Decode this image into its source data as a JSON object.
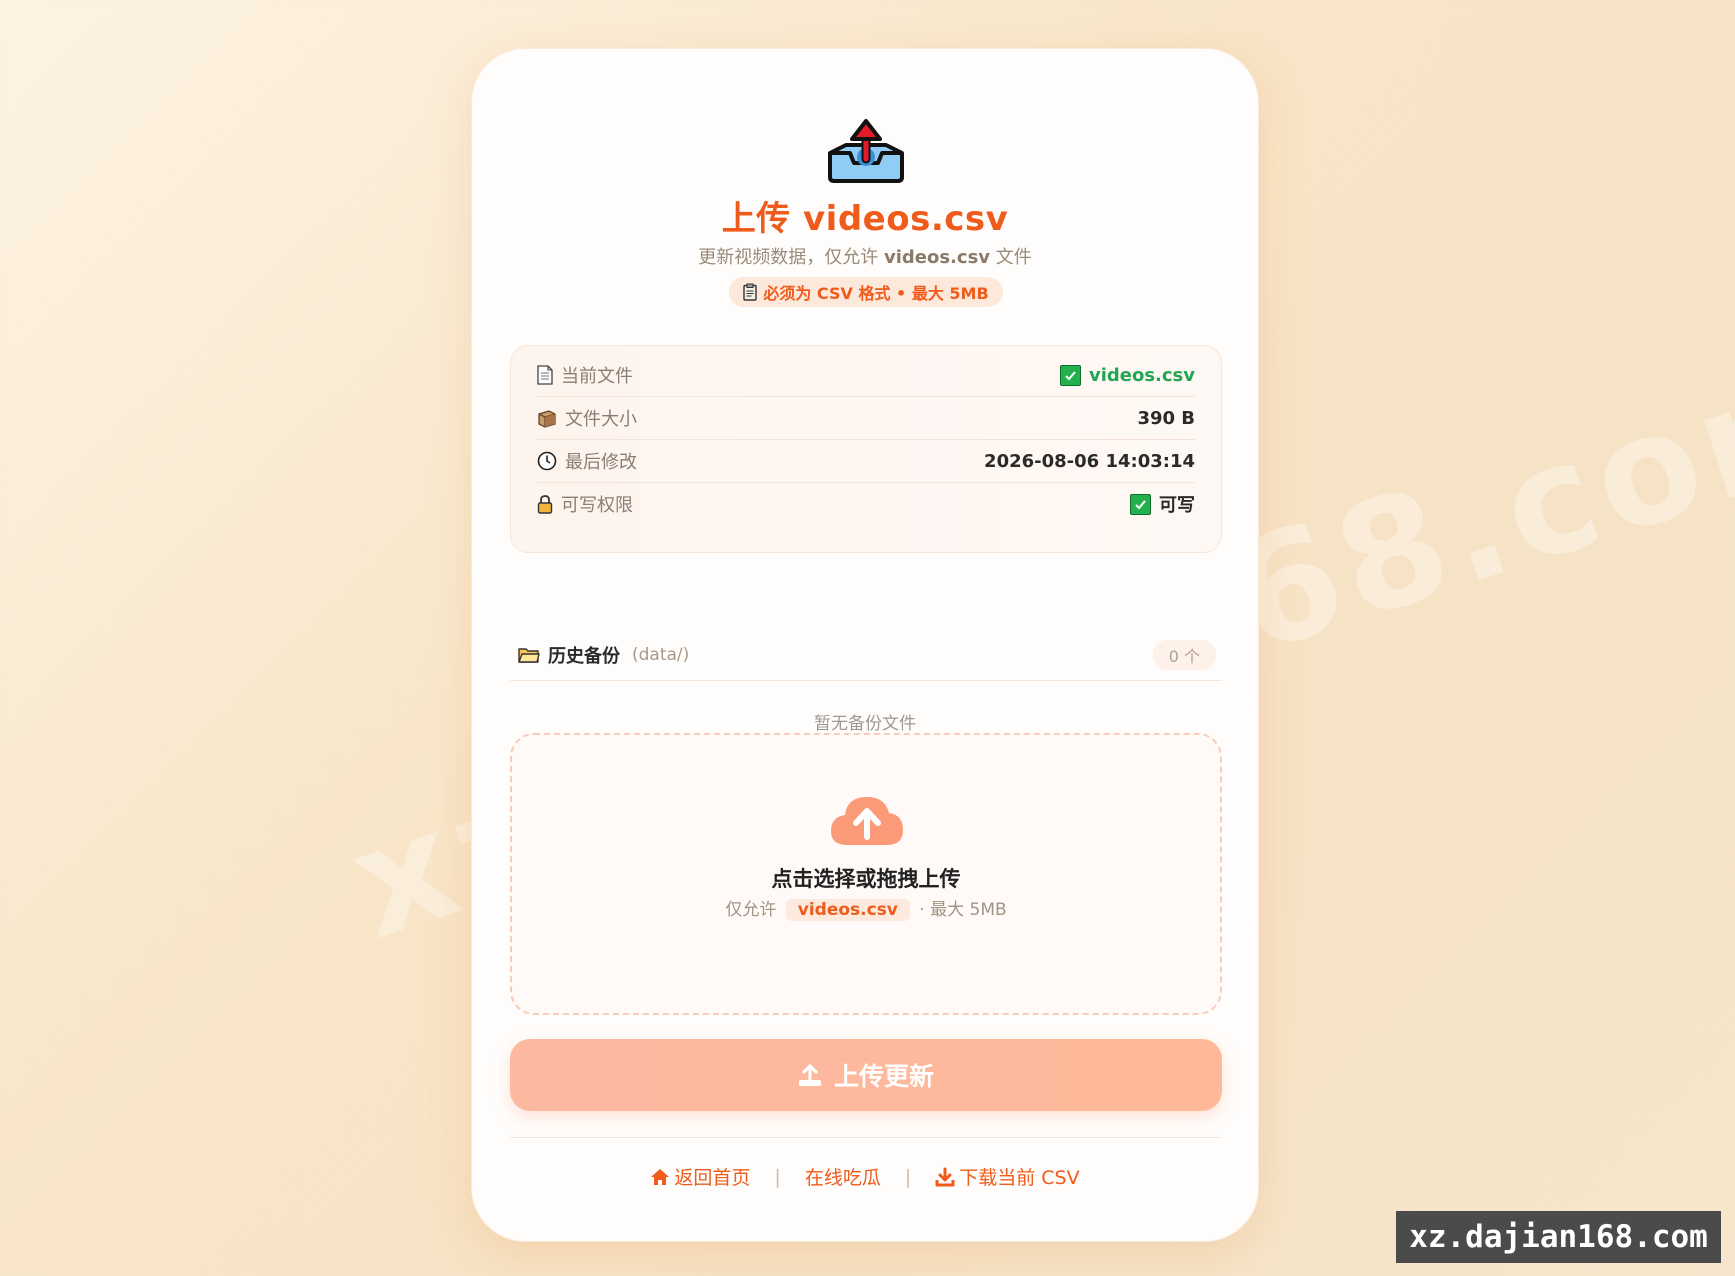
{
  "page": {
    "title": "上传 videos.csv",
    "subtitle_prefix": "更新视频数据，仅允许",
    "subtitle_file": "videos.csv",
    "subtitle_suffix": "文件",
    "format_pill": "必须为 CSV 格式 • 最大 5MB"
  },
  "info": {
    "rows": [
      {
        "label": "当前文件",
        "value": "videos.csv",
        "icon": "document-icon"
      },
      {
        "label": "文件大小",
        "value": "390 B",
        "icon": "package-icon"
      },
      {
        "label": "最后修改",
        "value": "2026-08-06 14:03:14",
        "icon": "clock-icon"
      },
      {
        "label": "可写权限",
        "value": "可写",
        "icon": "lock-icon"
      }
    ]
  },
  "backup": {
    "title": "历史备份",
    "path": "(data/)",
    "count": "0 个",
    "empty": "暂无备份文件"
  },
  "dropzone": {
    "title": "点击选择或拖拽上传",
    "hint_prefix": "仅允许",
    "hint_file": "videos.csv",
    "hint_suffix": "· 最大 5MB"
  },
  "upload_button": {
    "label": "上传更新"
  },
  "footer": {
    "home": "返回首页",
    "online": "在线吃瓜",
    "download": "下载当前 CSV",
    "separator": "|"
  },
  "watermark": {
    "bg_text": "xz.dajian168.com",
    "badge": "xz.dajian168.com"
  },
  "colors": {
    "accent": "#ef5b1a",
    "success": "#22a653",
    "button": "#ffb899"
  }
}
